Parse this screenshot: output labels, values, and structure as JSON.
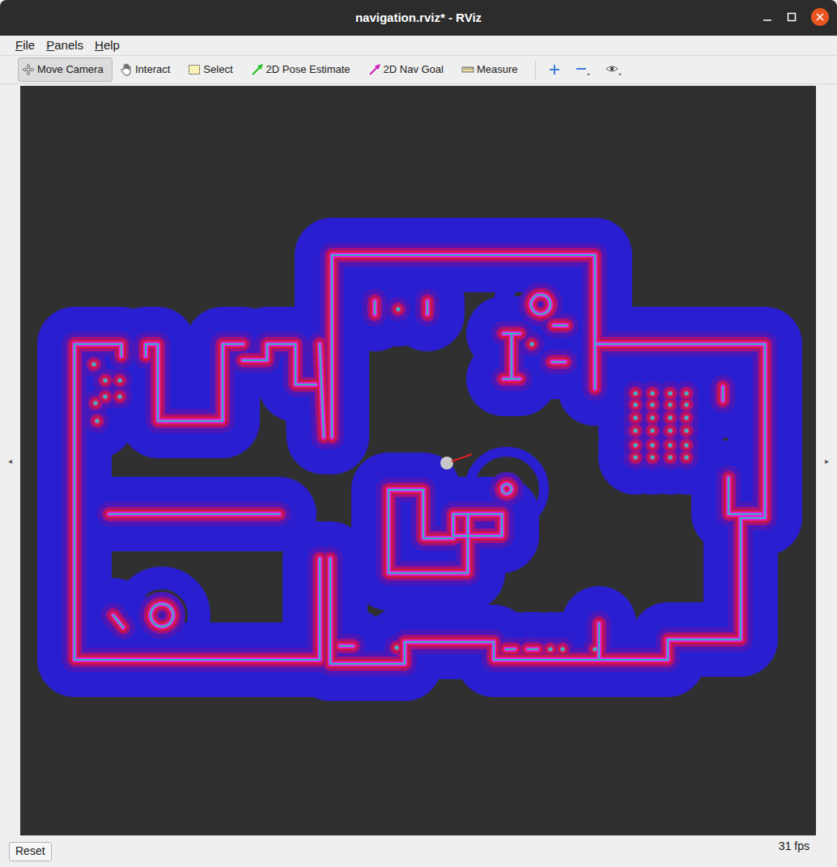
{
  "window": {
    "title": "navigation.rviz* - RViz"
  },
  "menu": [
    {
      "label": "File",
      "mnemonic_index": 0
    },
    {
      "label": "Panels",
      "mnemonic_index": 0
    },
    {
      "label": "Help",
      "mnemonic_index": 0
    }
  ],
  "toolbar": {
    "tools": [
      {
        "label": "Move Camera",
        "kind": "move",
        "selected": true
      },
      {
        "label": "Interact",
        "kind": "interact",
        "selected": false
      },
      {
        "label": "Select",
        "kind": "select",
        "selected": false
      },
      {
        "label": "2D Pose Estimate",
        "kind": "pose",
        "selected": false
      },
      {
        "label": "2D Nav Goal",
        "kind": "goal",
        "selected": false
      },
      {
        "label": "Measure",
        "kind": "measure",
        "selected": false
      }
    ]
  },
  "side_handles": {
    "left": "◂",
    "right": "▸"
  },
  "status_bar": {
    "button": "Reset",
    "fps": "31 fps"
  }
}
